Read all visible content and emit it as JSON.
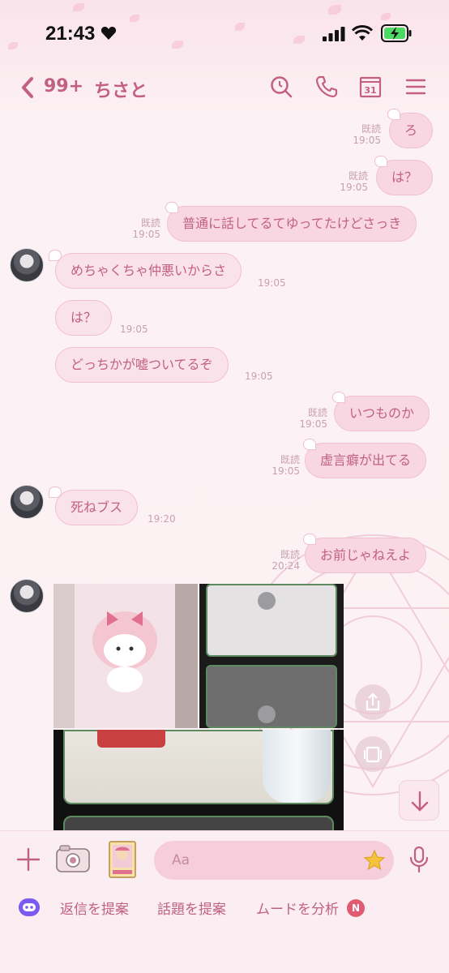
{
  "status_bar": {
    "time": "21:43"
  },
  "header": {
    "unread_count": "99+",
    "title": "ちさと"
  },
  "messages": [
    {
      "side": "out",
      "text": "ろ",
      "read": "既読",
      "time": "19:05"
    },
    {
      "side": "out",
      "text": "は？",
      "read": "既読",
      "time": "19:05"
    },
    {
      "side": "out",
      "text": "普通に話してるてゆってたけどさっき",
      "read": "既読",
      "time": "19:05"
    },
    {
      "side": "in",
      "text": "めちゃくちゃ仲悪いからさ",
      "time": "19:05"
    },
    {
      "side": "in",
      "text": "は？",
      "time": "19:05"
    },
    {
      "side": "in",
      "text": "どっちかが嘘ついてるぞ",
      "time": "19:05"
    },
    {
      "side": "out",
      "text": "いつものか",
      "read": "既読",
      "time": "19:05"
    },
    {
      "side": "out",
      "text": "虚言癖が出てる",
      "read": "既読",
      "time": "19:05"
    },
    {
      "side": "in",
      "text": "死ねブス",
      "time": "19:20"
    },
    {
      "side": "out",
      "text": "お前じゃねえよ",
      "read": "既読",
      "time": "20:24"
    }
  ],
  "input": {
    "placeholder": "Aa"
  },
  "suggestions": {
    "reply": "返信を提案",
    "topic": "話題を提案",
    "mood": "ムードを分析",
    "mood_badge": "N"
  },
  "colors": {
    "accent": "#c2607f",
    "bubble": "#f8d7e2",
    "background": "#fcf2f5"
  },
  "icons": [
    "back-icon",
    "search-icon",
    "phone-icon",
    "calendar-icon",
    "menu-icon",
    "share-icon",
    "save-icon",
    "scroll-down-icon",
    "plus-icon",
    "camera-icon",
    "sticker-card-icon",
    "star-icon",
    "mic-icon",
    "ai-assistant-icon"
  ]
}
